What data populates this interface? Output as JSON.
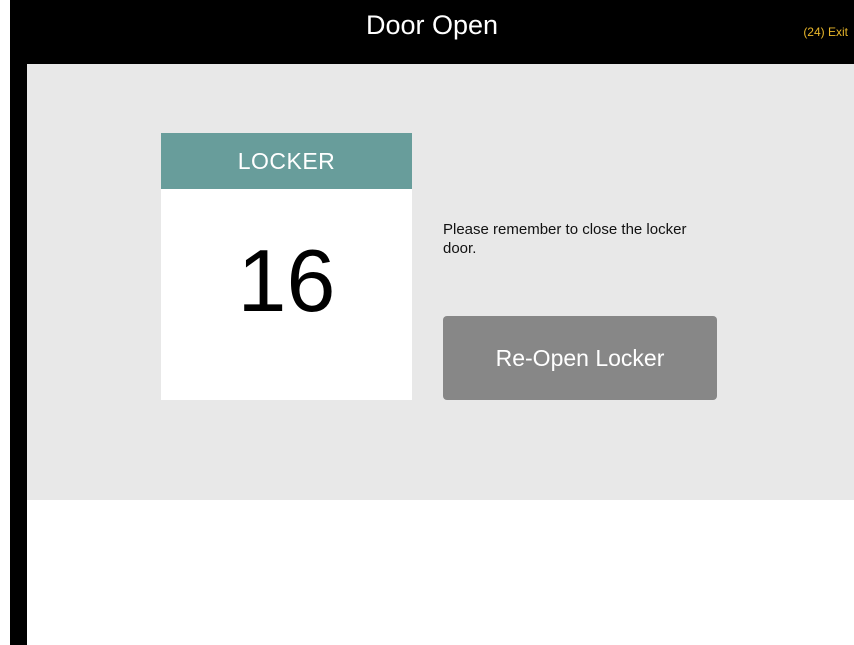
{
  "header": {
    "title": "Door Open",
    "exit_label": "(24) Exit"
  },
  "locker": {
    "label": "LOCKER",
    "number": "16"
  },
  "main": {
    "message": "Please remember to close the locker door.",
    "reopen_label": "Re-Open Locker"
  },
  "colors": {
    "accent": "#689d9b",
    "exit": "#e8b62a",
    "button": "#878787",
    "background": "#e8e8e8"
  }
}
